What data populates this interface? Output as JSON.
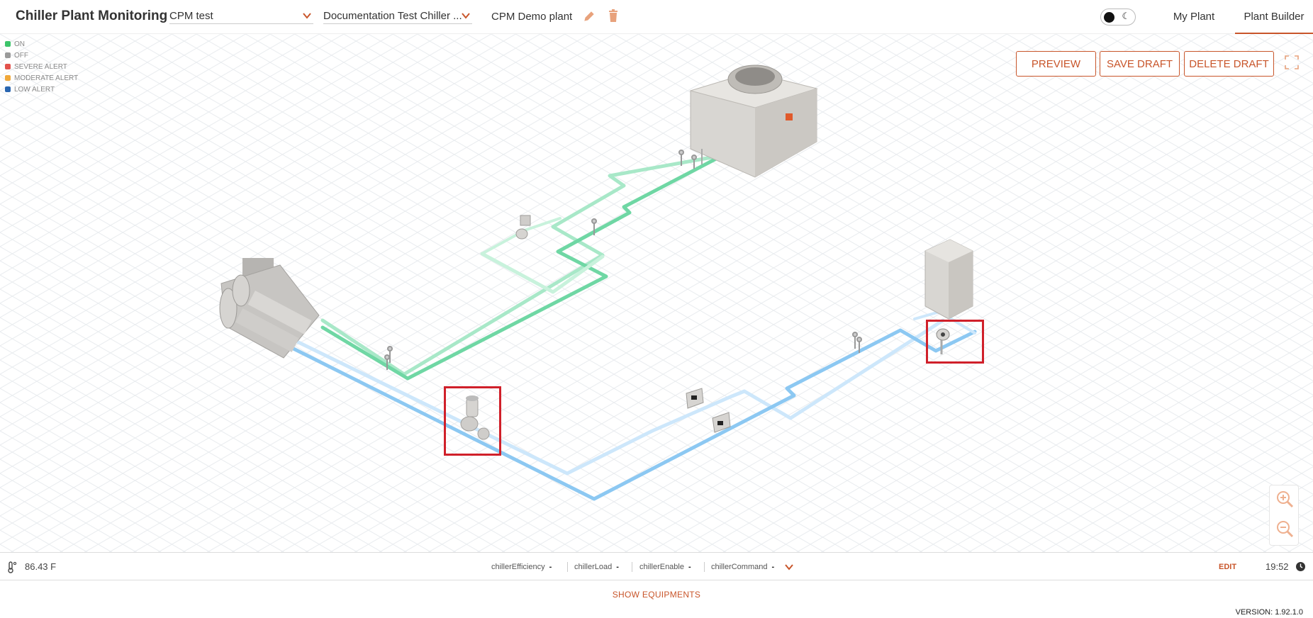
{
  "header": {
    "app_title": "Chiller Plant Monitoring",
    "site_select": "CPM test",
    "plant_select": "Documentation Test Chiller ...",
    "plant_name": "CPM Demo plant",
    "tabs": [
      {
        "label": "My Plant",
        "active": false
      },
      {
        "label": "Plant Builder",
        "active": true
      }
    ],
    "theme_toggle": "dark mode toggle",
    "accent": "#c8552a"
  },
  "legend": {
    "items": [
      {
        "label": "ON",
        "color": "#3cc46a"
      },
      {
        "label": "OFF",
        "color": "#9a9a9a"
      },
      {
        "label": "SEVERE ALERT",
        "color": "#e2524c"
      },
      {
        "label": "MODERATE ALERT",
        "color": "#f0a83a"
      },
      {
        "label": "LOW ALERT",
        "color": "#2a66b0"
      }
    ]
  },
  "actions": {
    "preview": "PREVIEW",
    "save_draft": "SAVE DRAFT",
    "delete_draft": "DELETE DRAFT"
  },
  "canvas": {
    "pipe_colors": {
      "condenser": "#a8e8c8",
      "condenser_dark": "#6fd7a4",
      "chilled": "#cde7fb",
      "chilled_dark": "#8cc8f2"
    },
    "highlight_color": "#d0202a"
  },
  "statusbar": {
    "temperature": "86.43 F",
    "metrics": [
      {
        "name": "chillerEfficiency",
        "value": "-"
      },
      {
        "name": "chillerLoad",
        "value": "-"
      },
      {
        "name": "chillerEnable",
        "value": "-"
      },
      {
        "name": "chillerCommand",
        "value": "-"
      }
    ],
    "edit_label": "EDIT",
    "time": "19:52"
  },
  "footer": {
    "show_equipments": "SHOW EQUIPMENTS",
    "version": "VERSION: 1.92.1.0"
  }
}
